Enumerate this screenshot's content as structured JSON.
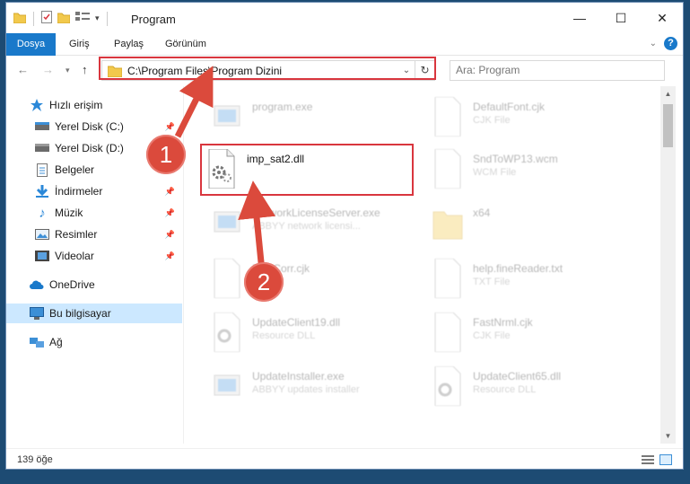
{
  "window": {
    "title": "Program"
  },
  "ribbon": {
    "tabs": [
      "Dosya",
      "Giriş",
      "Paylaş",
      "Görünüm"
    ]
  },
  "address": {
    "path": "C:\\Program Files\\Program Dizini"
  },
  "search": {
    "placeholder": "Ara: Program"
  },
  "sidebar": {
    "items": [
      {
        "label": "Hızlı erişim"
      },
      {
        "label": "Yerel Disk (C:)"
      },
      {
        "label": "Yerel Disk (D:)"
      },
      {
        "label": "Belgeler"
      },
      {
        "label": "İndirmeler"
      },
      {
        "label": "Müzik"
      },
      {
        "label": "Resimler"
      },
      {
        "label": "Videolar"
      },
      {
        "label": "OneDrive"
      },
      {
        "label": "Bu bilgisayar"
      },
      {
        "label": "Ağ"
      }
    ]
  },
  "files": {
    "highlighted": {
      "name": "imp_sat2.dll"
    },
    "left": [
      {
        "name": "program.exe",
        "type": ""
      },
      {
        "name": "NetworkLicenseServer.exe",
        "type": "ABBYY network licensi..."
      },
      {
        "name": "FineCorr.cjk",
        "type": ""
      },
      {
        "name": "UpdateClient19.dll",
        "type": "Resource DLL"
      },
      {
        "name": "UpdateInstaller.exe",
        "type": "ABBYY updates installer"
      }
    ],
    "right": [
      {
        "name": "DefaultFont.cjk",
        "type": "CJK File"
      },
      {
        "name": "SndToWP13.wcm",
        "type": "WCM File"
      },
      {
        "name": "x64",
        "type": ""
      },
      {
        "name": "help.fineReader.txt",
        "type": "TXT File"
      },
      {
        "name": "FastNrml.cjk",
        "type": "CJK File"
      },
      {
        "name": "UpdateClient65.dll",
        "type": "Resource DLL"
      }
    ]
  },
  "status": {
    "count": "139 öğe"
  },
  "annotations": {
    "badge1": "1",
    "badge2": "2"
  },
  "colors": {
    "accent": "#1979ca",
    "highlight": "#d9363e",
    "badge": "#db4a3c"
  }
}
